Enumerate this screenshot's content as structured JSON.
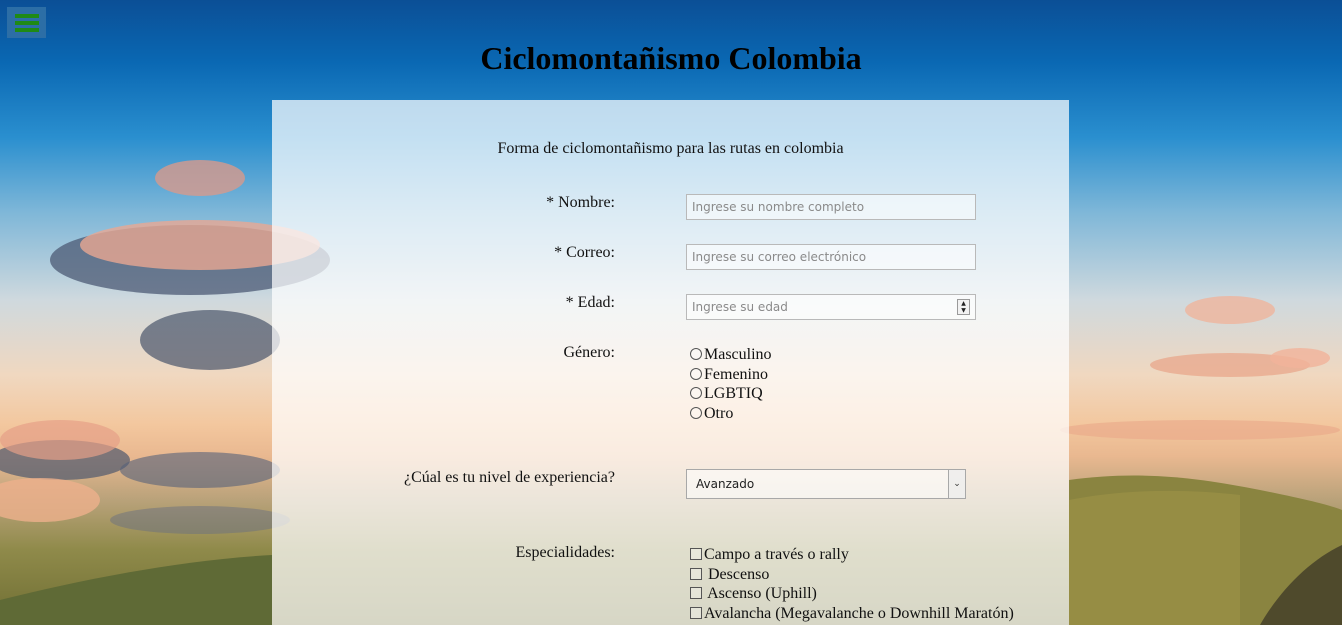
{
  "header": {
    "menu_icon": "hamburger-menu-icon",
    "title": "Ciclomontañismo Colombia"
  },
  "form": {
    "subtitle": "Forma de ciclomontañismo para las rutas en colombia",
    "nombre": {
      "label": "* Nombre:",
      "placeholder": "Ingrese su nombre completo"
    },
    "correo": {
      "label": "* Correo:",
      "placeholder": "Ingrese su correo electrónico"
    },
    "edad": {
      "label": "* Edad:",
      "placeholder": "Ingrese su edad"
    },
    "genero": {
      "label": "Género:",
      "options": [
        "Masculino",
        "Femenino",
        "LGBTIQ",
        "Otro"
      ]
    },
    "experiencia": {
      "label": "¿Cúal es tu nivel de experiencia?",
      "selected": "Avanzado"
    },
    "especialidades": {
      "label": "Especialidades:",
      "options": [
        "Campo a través o rally",
        " Descenso",
        " Ascenso (Uphill)",
        "Avalancha (Megavalanche o Downhill Maratón)"
      ]
    }
  },
  "colors": {
    "menu_button_bg": "#2c6ea6",
    "menu_bars": "#1f8a16",
    "panel_bg": "rgba(255,255,255,0.72)"
  }
}
